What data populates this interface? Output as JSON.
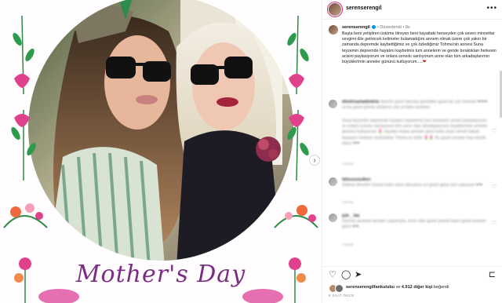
{
  "post": {
    "username": "serenserengil",
    "more_icon": "ellipsis-icon",
    "caption_edited": "Düzenlendi",
    "caption_age": "8s",
    "caption_text": "Başta beni yetiştiren üstüme titreyen beni hayattaki herseyden çok seven minnettar sevgimi dile getirecek kelimeler bulamadığım annem olmak üzere çok yakın bir zamanda depremde kaybettiğimiz ve çok özlediğimiz Tohma'nin annesi Suna teyzemin depremde hayatını kaybetmis tum annelerin ve geride bıraktıkları herkesin acisini paylasiyorum ve onlara sımsıkı sarılıyorum anne olan tüm arkadaşlarımın büyüklerimin anneler gününü kutluyorum.....",
    "caption_heart": "❤",
    "image_text": "Mother's Day",
    "next_icon": "chevron-right-icon"
  },
  "comments": [
    {
      "user": "dimitrisartadimitria",
      "text": "Sizlerin güzel ailenize gönülden güzel bir yüz Serenin ❤❤❤ ve bu güzel günün anlamını çok iyi bilen anneme",
      "meta": "Yanıtla"
    },
    {
      "user": "",
      "text": "Suna teyzemin depremde hayatını kaybetmis tum annelerin acisini paylasiyorum ve onlara sımsıkı sarılıyorum tüm anne olan arkadaşlarımın büyüklerimin anneler gününü kutluyorum 🌷 hayatta onlara anneler günü kutlu olsun anneli babalı büyüyen herkese mutluluklar Tohma ve Selin 🌷🌷 Bu güzel anneler hep sizinle olsun ❤❤",
      "meta": "Yanıtla"
    },
    {
      "user": "fatiuzunoulken",
      "text": "Selenin Anneler Günün kutlu olsun dünyanın en güzel günü size yakışıyor ❤❤",
      "meta": "Yanıtla"
    },
    {
      "user": "pyk__laq",
      "text": "Devrimi anneleri anneler yaşamıyla, anne olan güzel yürekli kadın güzel anneler günü ❤❤",
      "meta": "Yanıtla"
    }
  ],
  "actions": {
    "like_icon": "heart-outline-icon",
    "comment_icon": "comment-icon",
    "share_icon": "share-icon",
    "save_icon": "bookmark-icon"
  },
  "likes": {
    "first_user": "serenserengilfankulubu",
    "connector": "ve",
    "others": "4.912 diğer kişi",
    "suffix": "beğendi"
  },
  "date": "8 SAAT ÖNCE"
}
